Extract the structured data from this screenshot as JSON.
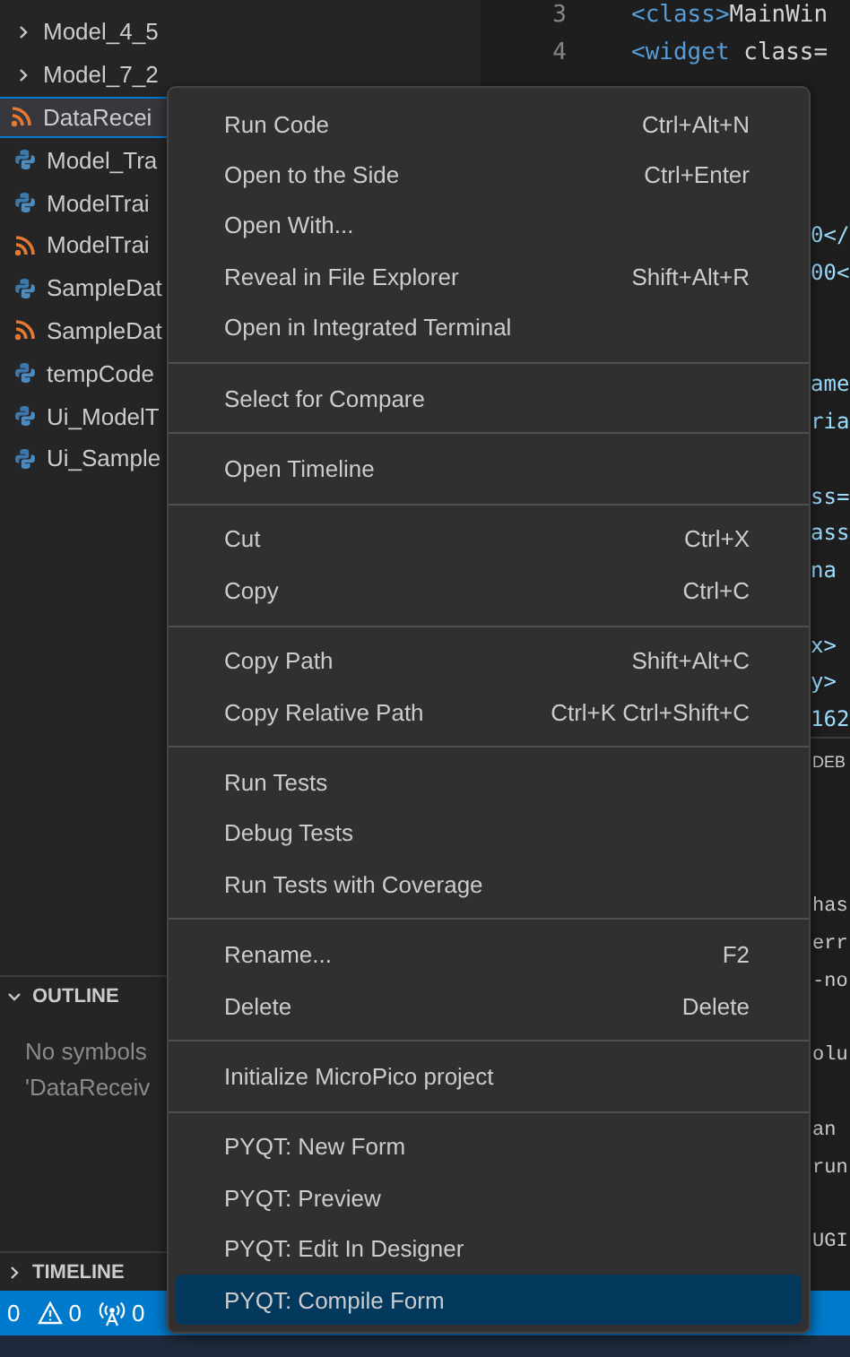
{
  "explorer": {
    "items": [
      {
        "label": "Model_4_5",
        "kind": "folder",
        "selected": false
      },
      {
        "label": "Model_7_2",
        "kind": "folder",
        "selected": false
      },
      {
        "label": "DataRecei",
        "kind": "xml",
        "selected": true
      },
      {
        "label": "Model_Tra",
        "kind": "python",
        "selected": false
      },
      {
        "label": "ModelTrai",
        "kind": "python",
        "selected": false
      },
      {
        "label": "ModelTrai",
        "kind": "xml",
        "selected": false
      },
      {
        "label": "SampleDat",
        "kind": "python",
        "selected": false
      },
      {
        "label": "SampleDat",
        "kind": "xml",
        "selected": false
      },
      {
        "label": "tempCode",
        "kind": "python",
        "selected": false
      },
      {
        "label": "Ui_ModelT",
        "kind": "python",
        "selected": false
      },
      {
        "label": "Ui_Sample",
        "kind": "python",
        "selected": false
      }
    ]
  },
  "outline": {
    "title": "OUTLINE",
    "expanded": true,
    "message": [
      "No symbols",
      "'DataReceiv"
    ]
  },
  "timeline": {
    "title": "TIMELINE",
    "expanded": false
  },
  "editor": {
    "lines": [
      {
        "number": "3",
        "tag": "<class>",
        "text": "MainWin"
      },
      {
        "number": "4",
        "tag": "<widget",
        "text": " class="
      }
    ],
    "fragments": [
      "0</",
      "00<",
      "ame",
      "ria",
      "ss=",
      "ass",
      "na",
      "x>",
      "y>",
      "162"
    ]
  },
  "panel": {
    "tab": "DEB",
    "fragments": [
      "has",
      "err",
      "-no",
      "olu",
      "an",
      "run",
      "UGI"
    ]
  },
  "status_bar": [
    {
      "kind": "errors",
      "count": "0"
    },
    {
      "kind": "warnings",
      "count": "0"
    },
    {
      "kind": "ports",
      "count": "0"
    }
  ],
  "context_menu": {
    "groups": [
      [
        {
          "label": "Run Code",
          "shortcut": "Ctrl+Alt+N",
          "selected": false
        },
        {
          "label": "Open to the Side",
          "shortcut": "Ctrl+Enter",
          "selected": false
        },
        {
          "label": "Open With...",
          "selected": false
        },
        {
          "label": "Reveal in File Explorer",
          "shortcut": "Shift+Alt+R",
          "selected": false
        },
        {
          "label": "Open in Integrated Terminal",
          "selected": false
        }
      ],
      [
        {
          "label": "Select for Compare",
          "selected": false
        }
      ],
      [
        {
          "label": "Open Timeline",
          "selected": false
        }
      ],
      [
        {
          "label": "Cut",
          "shortcut": "Ctrl+X",
          "selected": false
        },
        {
          "label": "Copy",
          "shortcut": "Ctrl+C",
          "selected": false
        }
      ],
      [
        {
          "label": "Copy Path",
          "shortcut": "Shift+Alt+C",
          "selected": false
        },
        {
          "label": "Copy Relative Path",
          "shortcut": "Ctrl+K Ctrl+Shift+C",
          "selected": false
        }
      ],
      [
        {
          "label": "Run Tests",
          "selected": false
        },
        {
          "label": "Debug Tests",
          "selected": false
        },
        {
          "label": "Run Tests with Coverage",
          "selected": false
        }
      ],
      [
        {
          "label": "Rename...",
          "shortcut": "F2",
          "selected": false
        },
        {
          "label": "Delete",
          "shortcut": "Delete",
          "selected": false
        }
      ],
      [
        {
          "label": "Initialize MicroPico project",
          "selected": false
        }
      ],
      [
        {
          "label": "PYQT: New Form",
          "selected": false
        },
        {
          "label": "PYQT: Preview",
          "selected": false
        },
        {
          "label": "PYQT: Edit In Designer",
          "selected": false
        },
        {
          "label": "PYQT: Compile Form",
          "selected": true
        }
      ]
    ]
  }
}
